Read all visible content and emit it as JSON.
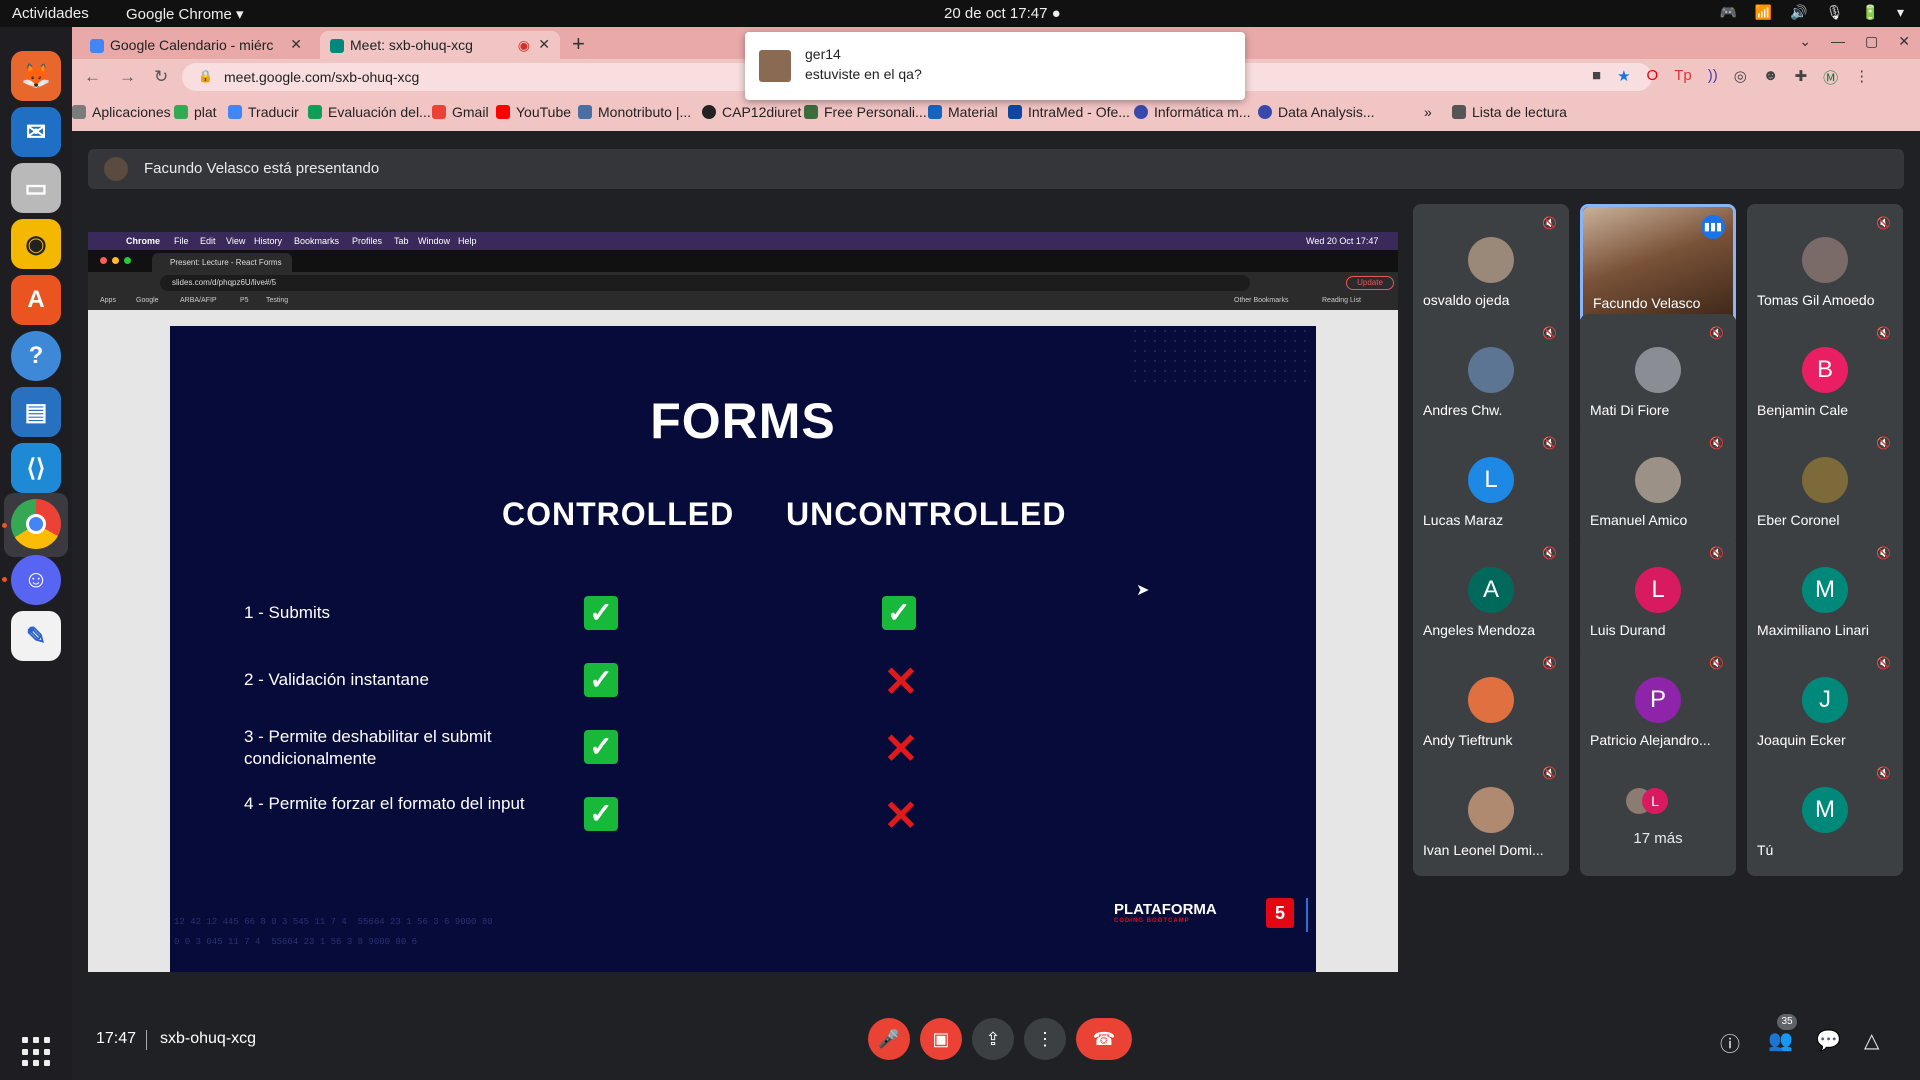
{
  "topbar": {
    "activities": "Actividades",
    "app": "Google Chrome ▾",
    "clock": "20 de oct  17:47  ●"
  },
  "browser": {
    "tabs": [
      {
        "label": "Google Calendario - miérc",
        "favicon_color": "#4285f4"
      },
      {
        "label": "Meet: sxb-ohuq-xcg",
        "favicon_color": "#00897b"
      }
    ],
    "url": "meet.google.com/sxb-ohuq-xcg",
    "bookmarks": [
      {
        "label": "Aplicaciones",
        "color": "#7b7b7b"
      },
      {
        "label": "plat",
        "color": "#34a853"
      },
      {
        "label": "Traducir",
        "color": "#4285f4"
      },
      {
        "label": "Evaluación del...",
        "color": "#0f9d58"
      },
      {
        "label": "Gmail",
        "color": "#ea4335"
      },
      {
        "label": "YouTube",
        "color": "#ff0000"
      },
      {
        "label": "Monotributo |...",
        "color": "#4a6fa5"
      },
      {
        "label": "CAP12diuret",
        "color": "#222222"
      },
      {
        "label": "Free Personali...",
        "color": "#3b6e3b"
      },
      {
        "label": "Material",
        "color": "#1565c0"
      },
      {
        "label": "IntraMed - Ofe...",
        "color": "#0d47a1"
      },
      {
        "label": "Informática m...",
        "color": "#3949ab"
      },
      {
        "label": "Data Analysis...",
        "color": "#3949ab"
      }
    ],
    "reading_list": "Lista de lectura",
    "more": "»"
  },
  "notification": {
    "name": "ger14",
    "message": "estuviste en el qa?"
  },
  "meet": {
    "presenting": "Facundo Velasco está presentando",
    "time": "17:47",
    "code": "sxb-ohuq-xcg",
    "participant_count": "35"
  },
  "shared_screen": {
    "menubar": [
      "Chrome",
      "File",
      "Edit",
      "View",
      "History",
      "Bookmarks",
      "Profiles",
      "Tab",
      "Window",
      "Help"
    ],
    "datetime": "Wed 20 Oct  17:47",
    "tab": "Present: Lecture - React Forms",
    "url": "slides.com/d/phqpz6U/live#/5",
    "update": "Update",
    "bookmarks": [
      "Apps",
      "Google",
      "ARBA/AFIP",
      "P5",
      "Testing"
    ],
    "other_bookmarks": "Other Bookmarks",
    "reading_list": "Reading List"
  },
  "slide": {
    "title": "FORMS",
    "col_controlled": "CONTROLLED",
    "col_uncontrolled": "UNCONTROLLED",
    "rows": [
      {
        "label": "1 - Submits",
        "controlled": true,
        "uncontrolled": true
      },
      {
        "label": "2 - Validación instantane",
        "controlled": true,
        "uncontrolled": false
      },
      {
        "label": "3 - Permite deshabilitar el submit condicionalmente",
        "controlled": true,
        "uncontrolled": false
      },
      {
        "label": "4 - Permite forzar el formato del input",
        "controlled": true,
        "uncontrolled": false
      }
    ],
    "brand": "PLATAFORMA",
    "brand_sub": "CODING BOOTCAMP",
    "brand_num": "5",
    "digits": "12 42 12 445 66 8 0 3 545 11 7 4  55664 23 1 56 3 6 9000 80\n0 0 3 045 11 7 4  55664 23 1 56 3 8 9000 80 6"
  },
  "participants": [
    {
      "name": "osvaldo ojeda",
      "initial": "",
      "color": "#9a8878",
      "muted": true
    },
    {
      "name": "Facundo Velasco",
      "initial": "",
      "color": "#6a4a32",
      "muted": false,
      "speaking": true
    },
    {
      "name": "Tomas Gil Amoedo",
      "initial": "",
      "color": "#7a6a68",
      "muted": true
    },
    {
      "name": "Andres Chw.",
      "initial": "",
      "color": "#5b7593",
      "muted": true
    },
    {
      "name": "Mati Di Fiore",
      "initial": "",
      "color": "#8a8e94",
      "muted": true
    },
    {
      "name": "Benjamin Cale",
      "initial": "B",
      "color": "#e91e63",
      "muted": true
    },
    {
      "name": "Lucas Maraz",
      "initial": "L",
      "color": "#1e88e5",
      "muted": true
    },
    {
      "name": "Emanuel Amico",
      "initial": "",
      "color": "#9b9186",
      "muted": true
    },
    {
      "name": "Eber Coronel",
      "initial": "",
      "color": "#7d6a3a",
      "muted": true
    },
    {
      "name": "Angeles Mendoza",
      "initial": "A",
      "color": "#00695c",
      "muted": true
    },
    {
      "name": "Luis Durand",
      "initial": "L",
      "color": "#d81b60",
      "muted": true
    },
    {
      "name": "Maximiliano Linari",
      "initial": "M",
      "color": "#00897b",
      "muted": true
    },
    {
      "name": "Andy Tieftrunk",
      "initial": "",
      "color": "#e07040",
      "muted": true
    },
    {
      "name": "Patricio Alejandro...",
      "initial": "P",
      "color": "#8e24aa",
      "muted": true
    },
    {
      "name": "Joaquin Ecker",
      "initial": "J",
      "color": "#00897b",
      "muted": true
    },
    {
      "name": "Ivan Leonel Domi...",
      "initial": "",
      "color": "#b08a70",
      "muted": true
    },
    {
      "name": "17 más",
      "initial": "L",
      "color": "#d81b60",
      "muted": false,
      "more": true
    },
    {
      "name": "Tú",
      "initial": "M",
      "color": "#00897b",
      "muted": true
    }
  ]
}
